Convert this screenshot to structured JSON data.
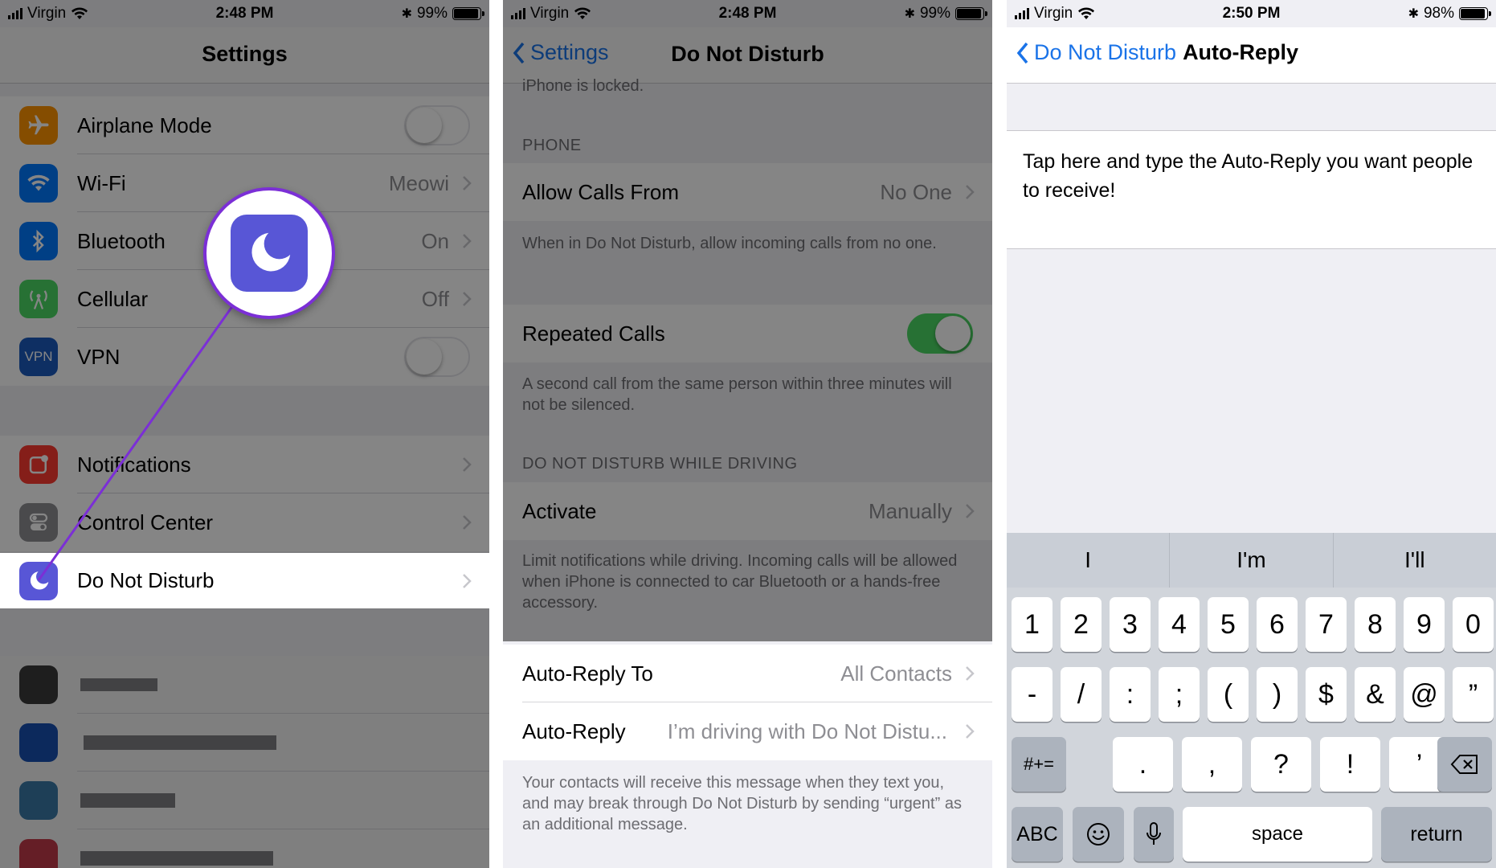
{
  "panel1": {
    "status": {
      "carrier": "Virgin",
      "time": "2:48 PM",
      "battery": "99%",
      "battery_level": 0.99
    },
    "title": "Settings",
    "rows": [
      {
        "label": "Airplane Mode",
        "value": "",
        "icon": "airplane-icon",
        "color": "#ff9500"
      },
      {
        "label": "Wi-Fi",
        "value": "Meowi",
        "icon": "wifi-icon",
        "color": "#007aff"
      },
      {
        "label": "Bluetooth",
        "value": "On",
        "icon": "bluetooth-icon",
        "color": "#007aff"
      },
      {
        "label": "Cellular",
        "value": "Off",
        "icon": "cellular-icon",
        "color": "#4cd964"
      },
      {
        "label": "VPN",
        "value": "",
        "icon_text": "VPN",
        "icon": "vpn-icon",
        "color": "#1c5bbf"
      },
      {
        "label": "Notifications",
        "value": "",
        "icon": "notifications-icon",
        "color": "#ff3b30"
      },
      {
        "label": "Control Center",
        "value": "",
        "icon": "control-center-icon",
        "color": "#8e8e93"
      },
      {
        "label": "Do Not Disturb",
        "value": "",
        "icon": "moon-icon",
        "color": "#5856d6"
      }
    ]
  },
  "panel2": {
    "status": {
      "carrier": "Virgin",
      "time": "2:48 PM",
      "battery": "99%",
      "battery_level": 0.99
    },
    "back": "Settings",
    "title": "Do Not Disturb",
    "top_cut_text": "iPhone is locked.",
    "phone_header": "PHONE",
    "allow_calls_label": "Allow Calls From",
    "allow_calls_value": "No One",
    "allow_calls_footer": "When in Do Not Disturb, allow incoming calls from no one.",
    "repeated_label": "Repeated Calls",
    "repeated_footer": "A second call from the same person within three minutes will not be silenced.",
    "driving_header": "DO NOT DISTURB WHILE DRIVING",
    "activate_label": "Activate",
    "activate_value": "Manually",
    "activate_footer": "Limit notifications while driving. Incoming calls will be allowed when iPhone is connected to car Bluetooth or a hands-free accessory.",
    "auto_reply_to_label": "Auto-Reply To",
    "auto_reply_to_value": "All Contacts",
    "auto_reply_label": "Auto-Reply",
    "auto_reply_value": "I’m driving with Do Not Distu...",
    "auto_reply_footer": "Your contacts will receive this message when they text you, and may break through Do Not Disturb by sending “urgent” as an additional message."
  },
  "panel3": {
    "status": {
      "carrier": "Virgin",
      "time": "2:50 PM",
      "battery": "98%",
      "battery_level": 0.98
    },
    "back": "Do Not Disturb",
    "title": "Auto-Reply",
    "text": "Tap here and type the Auto-Reply you want people to receive!",
    "suggestions": [
      "I",
      "I'm",
      "I'll"
    ],
    "row1": [
      "1",
      "2",
      "3",
      "4",
      "5",
      "6",
      "7",
      "8",
      "9",
      "0"
    ],
    "row2": [
      "-",
      "/",
      ":",
      ";",
      "(",
      ")",
      "$",
      "&",
      "@",
      "”"
    ],
    "row3": [
      ".",
      ",",
      "?",
      "!",
      "’"
    ],
    "sym_key": "#+=",
    "abc_key": "ABC",
    "space_key": "space",
    "return_key": "return"
  }
}
